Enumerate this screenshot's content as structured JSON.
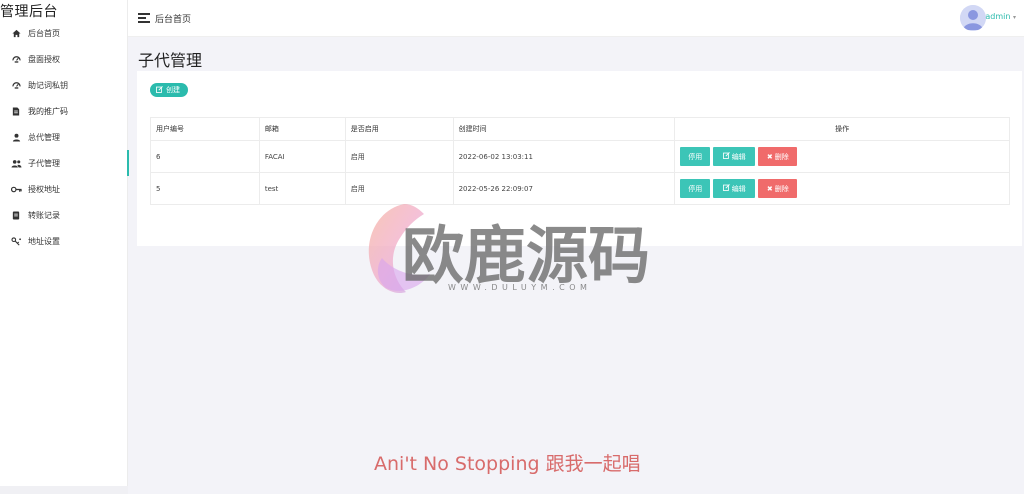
{
  "app": {
    "brand": "管理后台"
  },
  "sidebar": {
    "items": [
      {
        "label": "后台首页",
        "icon": "home-icon"
      },
      {
        "label": "盘面授权",
        "icon": "dashboard-icon"
      },
      {
        "label": "助记词私钥",
        "icon": "dashboard-icon"
      },
      {
        "label": "我的推广码",
        "icon": "document-icon"
      },
      {
        "label": "总代管理",
        "icon": "user-icon"
      },
      {
        "label": "子代管理",
        "icon": "users-icon",
        "active": true
      },
      {
        "label": "授权地址",
        "icon": "key-icon"
      },
      {
        "label": "转账记录",
        "icon": "list-icon"
      },
      {
        "label": "地址设置",
        "icon": "settings-key-icon"
      }
    ]
  },
  "topbar": {
    "title": "后台首页",
    "user": "admin"
  },
  "page": {
    "title": "子代管理",
    "create_label": "创建"
  },
  "table": {
    "headers": [
      "用户编号",
      "邮箱",
      "是否启用",
      "创建时间",
      "操作"
    ],
    "rows": [
      {
        "id": "6",
        "email": "FACAI",
        "enabled": "启用",
        "created": "2022-06-02 13:03:11"
      },
      {
        "id": "5",
        "email": "test",
        "enabled": "启用",
        "created": "2022-05-26 22:09:07"
      }
    ],
    "actions": {
      "disable": "停用",
      "edit": "编辑",
      "delete": "删除"
    }
  },
  "watermark": {
    "text": "欧鹿源码",
    "url": "WWW.DULUYM.COM"
  },
  "overlay": {
    "subtitle": "Ani't No Stopping 跟我一起唱"
  },
  "colors": {
    "accent": "#2bbbad",
    "danger": "#f06b6b",
    "background": "#f3f3f8"
  }
}
